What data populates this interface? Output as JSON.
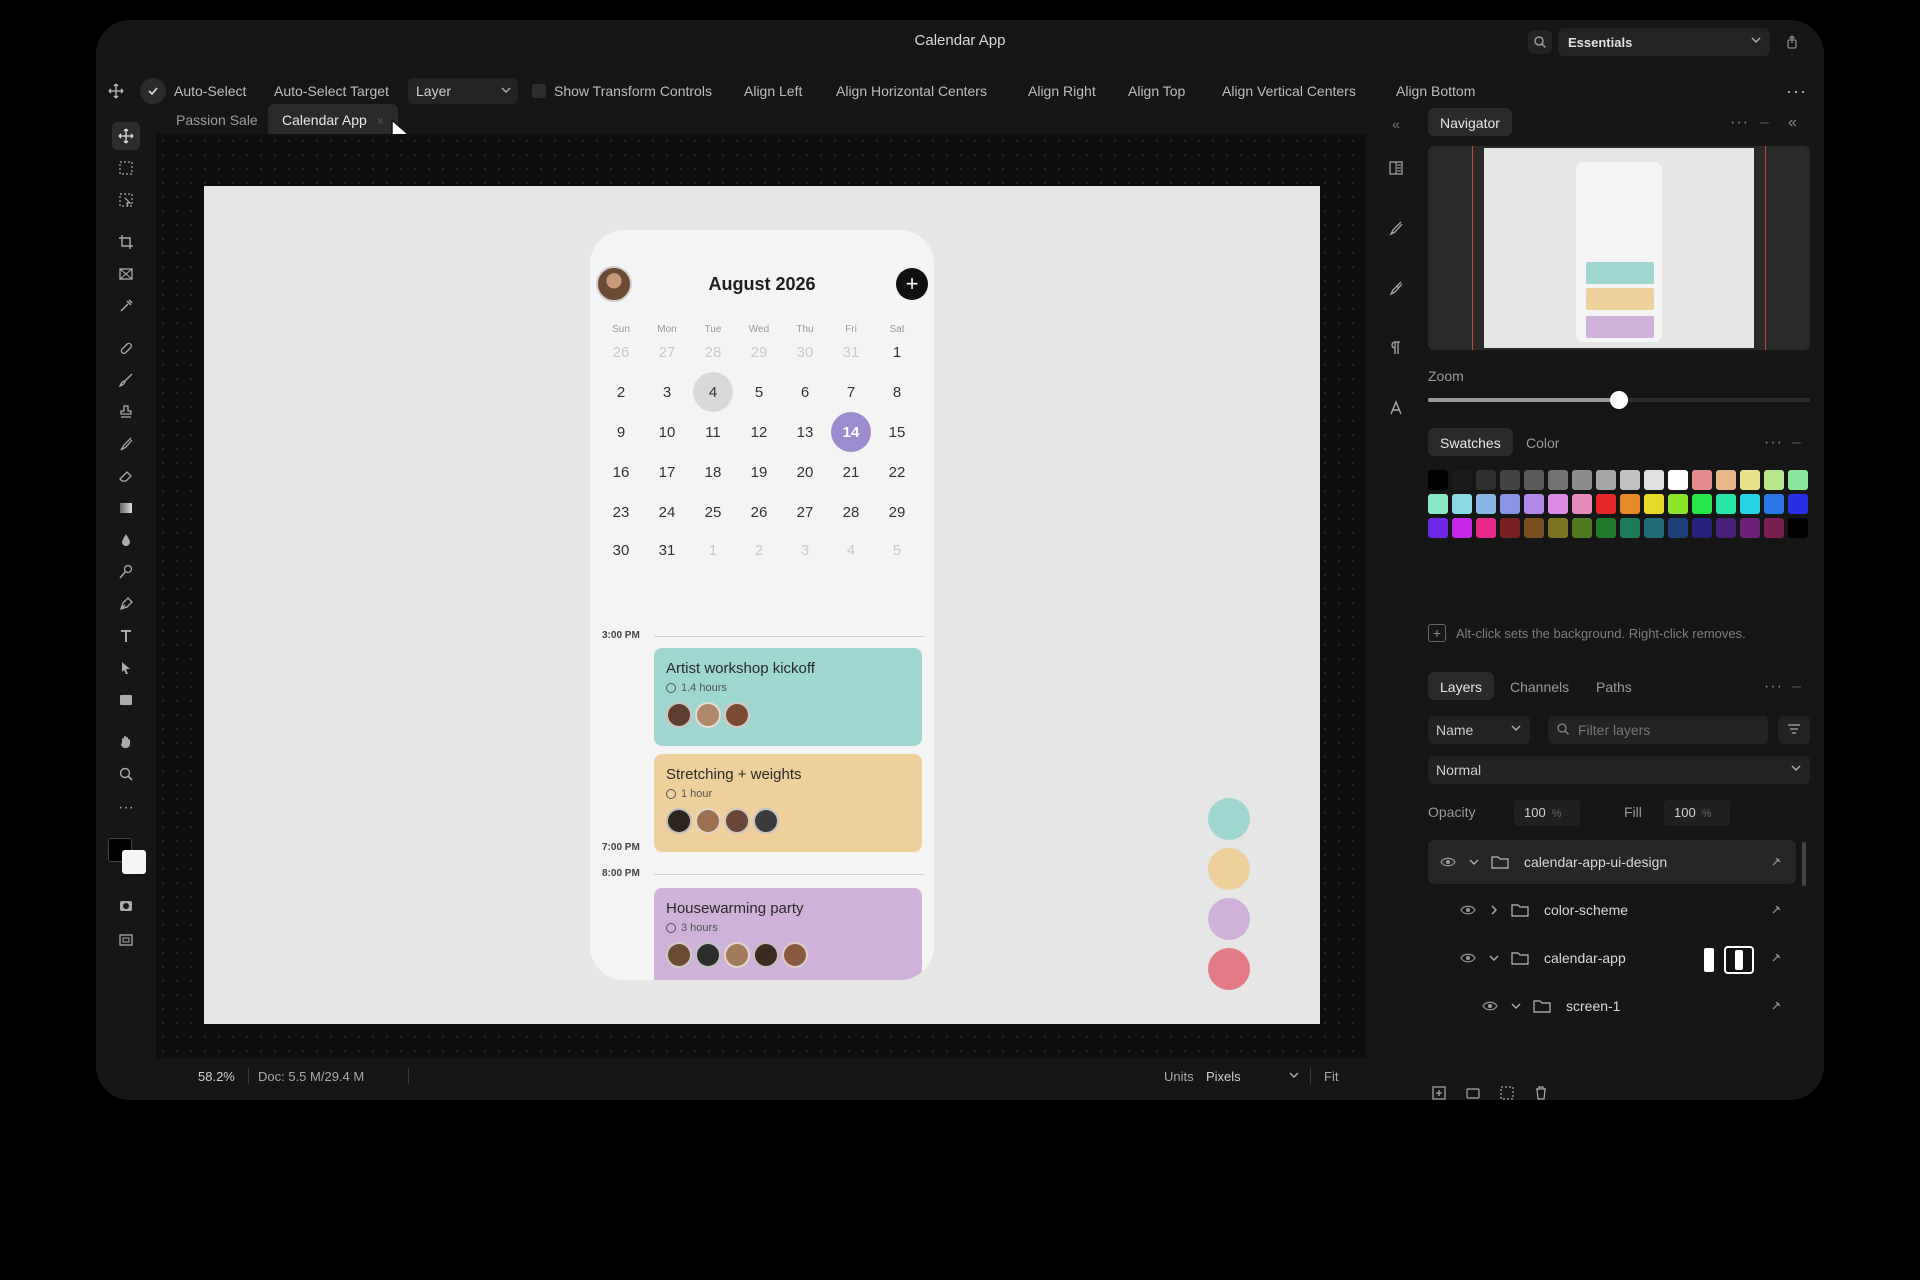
{
  "window": {
    "title": "Calendar App"
  },
  "workspace": {
    "selected": "Essentials"
  },
  "options_bar": {
    "auto_select": "Auto-Select",
    "auto_select_target": "Auto-Select Target",
    "layer_select": "Layer",
    "show_transform": "Show Transform Controls",
    "align_left": "Align Left",
    "align_hcenters": "Align Horizontal Centers",
    "align_right": "Align Right",
    "align_top": "Align Top",
    "align_vcenters": "Align Vertical Centers",
    "align_bottom": "Align Bottom"
  },
  "doc_tabs": [
    {
      "label": "Passion Sale"
    },
    {
      "label": "Calendar App",
      "active": true
    }
  ],
  "calendar": {
    "title": "August 2026",
    "dow": [
      "Sun",
      "Mon",
      "Tue",
      "Wed",
      "Thu",
      "Fri",
      "Sat"
    ],
    "weeks": [
      [
        "26",
        "27",
        "28",
        "29",
        "30",
        "31",
        "1"
      ],
      [
        "2",
        "3",
        "4",
        "5",
        "6",
        "7",
        "8"
      ],
      [
        "9",
        "10",
        "11",
        "12",
        "13",
        "14",
        "15"
      ],
      [
        "16",
        "17",
        "18",
        "19",
        "20",
        "21",
        "22"
      ],
      [
        "23",
        "24",
        "25",
        "26",
        "27",
        "28",
        "29"
      ],
      [
        "30",
        "31",
        "1",
        "2",
        "3",
        "4",
        "5"
      ]
    ],
    "today": "4",
    "selected": "14",
    "times": {
      "t1": "3:00 PM",
      "t2": "7:00 PM",
      "t3": "8:00 PM"
    },
    "events": [
      {
        "title": "Artist workshop kickoff",
        "duration": "1.4 hours",
        "color": "#9fd6cf",
        "attendees": 3
      },
      {
        "title": "Stretching + weights",
        "duration": "1 hour",
        "color": "#efcf9b",
        "attendees": 4
      },
      {
        "title": "Housewarming party",
        "duration": "3 hours",
        "color": "#cfb1da",
        "attendees": 5
      }
    ]
  },
  "color_dots": [
    "#9fd6cf",
    "#efcf9b",
    "#cfb1da",
    "#e37b86"
  ],
  "navigator": {
    "tab": "Navigator",
    "zoom_label": "Zoom",
    "zoom_fraction": 0.5
  },
  "swatches": {
    "tab_swatches": "Swatches",
    "tab_color": "Color",
    "hint": "Alt-click sets the background. Right-click removes.",
    "colors": [
      "#000000",
      "#1c1c1c",
      "#2f2f2f",
      "#444444",
      "#5a5a5a",
      "#727272",
      "#8c8c8c",
      "#a6a6a6",
      "#c2c2c2",
      "#e0e0e0",
      "#ffffff",
      "#e58b8b",
      "#e7b78a",
      "#e7e38a",
      "#b8e68a",
      "#8ae69b",
      "#8ae6c7",
      "#8ad9e6",
      "#8ab6e6",
      "#8a93e6",
      "#b08ae6",
      "#db8ae6",
      "#e68ab9",
      "#e62727",
      "#e68a27",
      "#e6d927",
      "#8ae627",
      "#27e64a",
      "#27e6a6",
      "#27d4e6",
      "#2777e6",
      "#2730e6",
      "#6e27e6",
      "#c427e6",
      "#e6278a",
      "#7a1f1f",
      "#7a4f1f",
      "#7a731f",
      "#4f7a1f",
      "#1f7a2b",
      "#1f7a59",
      "#1f6b7a",
      "#1f3f7a",
      "#25207a",
      "#48207a",
      "#6e207a",
      "#7a2050",
      "#000000"
    ]
  },
  "layers": {
    "tab_layers": "Layers",
    "tab_channels": "Channels",
    "tab_paths": "Paths",
    "filter_kind": "Name",
    "filter_placeholder": "Filter layers",
    "blend_mode": "Normal",
    "opacity_label": "Opacity",
    "opacity_value": "100",
    "fill_label": "Fill",
    "fill_value": "100",
    "pct": "%",
    "rows": [
      {
        "name": "calendar-app-ui-design"
      },
      {
        "name": "color-scheme"
      },
      {
        "name": "calendar-app"
      },
      {
        "name": "screen-1"
      }
    ]
  },
  "status": {
    "zoom": "58.2%",
    "doc": "Doc: 5.5 M/29.4 M",
    "units_label": "Units",
    "units_value": "Pixels",
    "fit": "Fit"
  }
}
